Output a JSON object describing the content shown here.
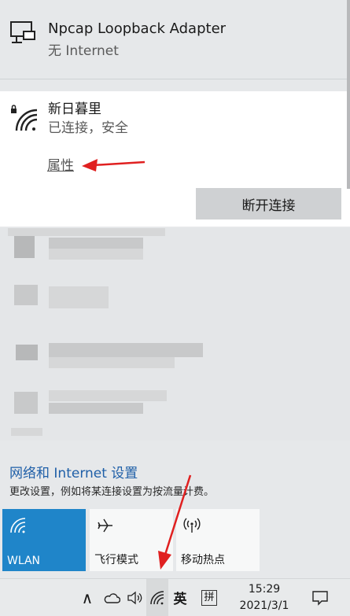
{
  "networks": [
    {
      "name": "Npcap Loopback Adapter",
      "status": "无 Internet",
      "icon": "ethernet-icon"
    },
    {
      "name": "新日暮里",
      "status": "已连接，安全",
      "icon": "wifi-secure-icon",
      "properties_label": "属性",
      "disconnect_label": "断开连接"
    }
  ],
  "settings": {
    "link_label": "网络和 Internet 设置",
    "description": "更改设置，例如将某连接设置为按流量计费。"
  },
  "quick_actions": [
    {
      "label": "WLAN",
      "icon": "wifi-icon",
      "active": true
    },
    {
      "label": "飞行模式",
      "icon": "airplane-icon",
      "active": false
    },
    {
      "label": "移动热点",
      "icon": "hotspot-icon",
      "active": false
    }
  ],
  "taskbar": {
    "chevron": "∧",
    "language": "英",
    "ime": "拼",
    "time": "15:29",
    "date": "2021/3/1"
  },
  "colors": {
    "accent": "#1f85c9",
    "link": "#1f5fa8",
    "annotation_arrow": "#e02020"
  }
}
